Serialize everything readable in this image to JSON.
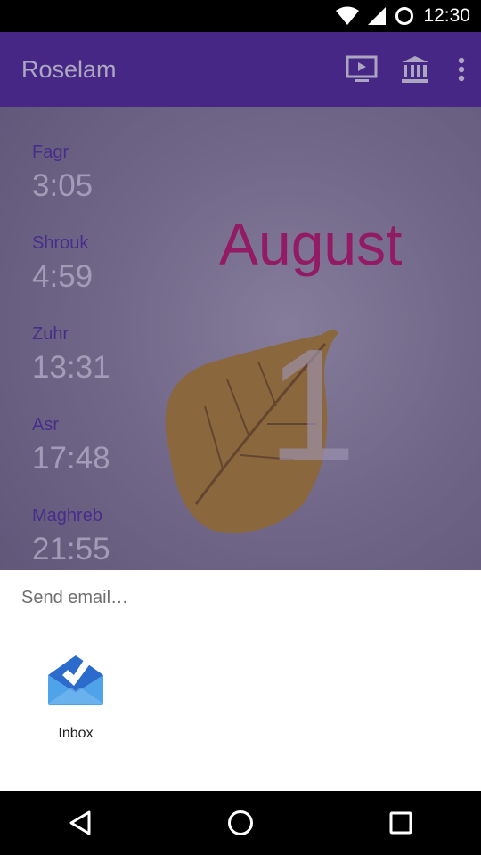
{
  "status_bar": {
    "time": "12:30",
    "icons": [
      "wifi-icon",
      "signal-icon",
      "circle-notification-icon"
    ]
  },
  "app_bar": {
    "title": "Roselam",
    "actions": [
      "tv-play-icon",
      "mosque-building-icon",
      "more-vert-icon"
    ],
    "color": "#5a32a2"
  },
  "prayers": [
    {
      "name": "Fagr",
      "time": "3:05"
    },
    {
      "name": "Shrouk",
      "time": "4:59"
    },
    {
      "name": "Zuhr",
      "time": "13:31"
    },
    {
      "name": "Asr",
      "time": "17:48"
    },
    {
      "name": "Maghreb",
      "time": "21:55"
    }
  ],
  "date": {
    "month": "August",
    "day": "1"
  },
  "share_sheet": {
    "title": "Send email…",
    "targets": [
      {
        "label": "Inbox",
        "icon": "inbox-envelope-icon"
      }
    ]
  },
  "nav_bar": {
    "buttons": [
      "back-icon",
      "home-icon",
      "recents-icon"
    ]
  },
  "colors": {
    "accent": "#d51e6b",
    "prayer_name": "#5b3ea8",
    "inbox_blue": "#4285f4"
  }
}
